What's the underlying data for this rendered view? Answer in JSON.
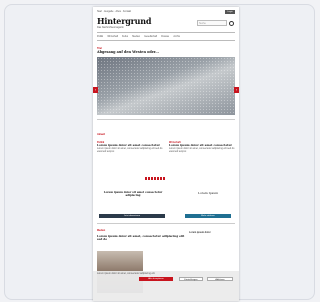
{
  "site": {
    "logo": "Hintergrund",
    "tagline": "Das Nachrichtenmagazin",
    "top_links": "Start · Ausgabe · Abos · Kontakt",
    "top_button": "Login",
    "search_placeholder": "Suche",
    "nav": [
      "Politik",
      "Wirtschaft",
      "Kultur",
      "Medien",
      "Gesellschaft",
      "Dossier",
      "Archiv"
    ]
  },
  "lead": {
    "kicker": "Titel",
    "headline": "Abgesang auf den Westen oder..."
  },
  "section_label": "Aktuell",
  "articles": [
    {
      "kicker": "Politik",
      "headline": "Lorem ipsum dolor sit amet consectetur",
      "teaser": "Lorem ipsum dolor sit amet, consectetur adipiscing elit sed do eiusmod tempor."
    },
    {
      "kicker": "Wirtschaft",
      "headline": "Lorem ipsum dolor sit amet consectetur",
      "teaser": "Lorem ipsum dolor sit amet, consectetur adipiscing elit sed do eiusmod tempor."
    }
  ],
  "promo": {
    "left_title": "Lorem ipsum dolor sit amet consectetur adipiscing",
    "left_button": "Jetzt abonnieren",
    "right_title": "Lorem Ipsum",
    "right_button": "Mehr erfahren"
  },
  "second": {
    "kicker": "Medien",
    "headline": "Lorem ipsum dolor sit amet, consectetur adipiscing elit sed do",
    "sidebar_title": "Lorem ipsum dolor"
  },
  "cookie": {
    "text": "Lorem ipsum dolor sit amet, consectetur adipiscing elit.",
    "accept": "Alle akzeptieren",
    "settings": "Einstellungen",
    "reject": "Ablehnen"
  }
}
